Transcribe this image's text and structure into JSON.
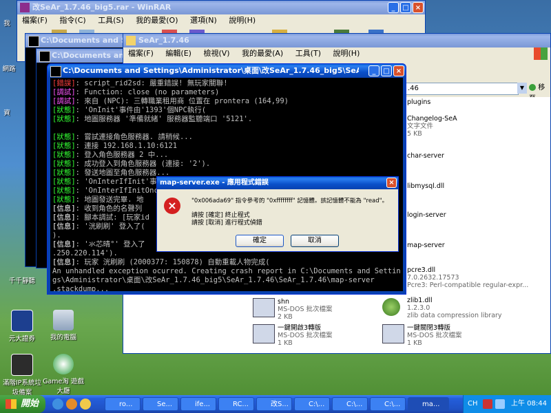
{
  "desktop": {
    "icons": [
      {
        "label": "我",
        "x": 0
      },
      {
        "label": "網路",
        "x": 0
      },
      {
        "label": "資",
        "x": 0
      },
      {
        "label": "千千靜聽"
      },
      {
        "label": "元大證券"
      },
      {
        "label": "我的電腦"
      },
      {
        "label": "滿階IP系統垃圾備案"
      },
      {
        "label": "Game淘 遊戲大廳"
      }
    ]
  },
  "winrar": {
    "title": "改SeAr_1.7.46_big5.rar - WinRAR",
    "menu": [
      "檔案(F)",
      "指令(C)",
      "工具(S)",
      "我的最愛(O)",
      "選項(N)",
      "說明(H)"
    ]
  },
  "cmd_back1": {
    "title": "C:\\Documents and Settings\\"
  },
  "cmd_back2": {
    "title": "C:\\Documents and Settings\\"
  },
  "explorer": {
    "title": "SeAr_1.7.46",
    "menu": [
      "檔案(F)",
      "編輯(E)",
      "檢視(V)",
      "我的最愛(A)",
      "工具(T)",
      "說明(H)"
    ],
    "address_value": ".46",
    "go_label": "移至",
    "files": [
      {
        "name": "plugins",
        "type": "",
        "size": ""
      },
      {
        "name": "Changelog-SeA",
        "type": "文字文件",
        "size": "5 KB"
      },
      {
        "name": "char-server",
        "type": "",
        "size": ""
      },
      {
        "name": "libmysql.dll",
        "type": "",
        "size": ""
      },
      {
        "name": "login-server",
        "type": "",
        "size": ""
      },
      {
        "name": "map-server",
        "type": "",
        "size": ""
      },
      {
        "name": "pcre3.dll",
        "type": "7.0.2632.17573",
        "size": "Pcre3: Perl-compatible regular-expr..."
      },
      {
        "name": "zlib1.dll",
        "type": "1.2.3.0",
        "size": "zlib data compression library"
      },
      {
        "name": "shn",
        "type": "MS-DOS 批次檔案",
        "size": "2 KB"
      },
      {
        "name": "一鍵開啟3轉版",
        "type": "MS-DOS 批次檔案",
        "size": "1 KB"
      },
      {
        "name": "一鍵關閉3轉版",
        "type": "MS-DOS 批次檔案",
        "size": "1 KB"
      },
      {
        "name": "",
        "type": "MS-DOS 批次檔案",
        "size": "1 KB"
      }
    ]
  },
  "console": {
    "title": "C:\\Documents and Settings\\Administrator\\桌面\\改SeAr_1.7.46_big5\\SeAr_1.7.46\\",
    "lines": [
      {
        "tag": "[錯誤]",
        "tag_color": "c-red",
        "text": ": script_rid2sd: 嚴重錯誤! 無玩家關聯!"
      },
      {
        "tag": "[調試]",
        "tag_color": "c-mag",
        "text": ": Function: close (no parameters)"
      },
      {
        "tag": "[調試]",
        "tag_color": "c-mag",
        "text": ": 來自 (NPC): 三轉職業租用商 位置在 prontera (164,99)"
      },
      {
        "tag": "[狀態]",
        "tag_color": "c-grn",
        "text": ": 'OnInit'事件由'1393'個NPC執行("
      },
      {
        "tag": "[狀態]",
        "tag_color": "c-grn",
        "text": ": 地圖服務器 '準備就緒' 服務器監聽端口 '5121'."
      },
      {
        "tag": "",
        "tag_color": "",
        "text": ""
      },
      {
        "tag": "[狀態]",
        "tag_color": "c-grn",
        "text": ": 嘗試連接角色服務器. 請稍候..."
      },
      {
        "tag": "[狀態]",
        "tag_color": "c-grn",
        "text": ": 連接 192.168.1.10:6121"
      },
      {
        "tag": "[狀態]",
        "tag_color": "c-grn",
        "text": ": 登入角色服務器 2 中..."
      },
      {
        "tag": "[狀態]",
        "tag_color": "c-grn",
        "text": ": 成功登入到角色服務器 (連接: '2')."
      },
      {
        "tag": "[狀態]",
        "tag_color": "c-grn",
        "text": ": 發送地圖至角色服務器..."
      },
      {
        "tag": "[狀態]",
        "tag_color": "c-grn",
        "text": ": 'OnInterIfInit'事"
      },
      {
        "tag": "[狀態]",
        "tag_color": "c-grn",
        "text": ": 'OnInterIfInitOnc"
      },
      {
        "tag": "[狀態]",
        "tag_color": "c-grn",
        "text": ": 地圖發送完畢. 地"
      },
      {
        "tag": "[信息]",
        "tag_color": "c-wht",
        "text": ": 收到角色的名聲列"
      },
      {
        "tag": "[信息]",
        "tag_color": "c-wht",
        "text": ": 腳本調試: [玩家id"
      },
      {
        "tag": "[信息]",
        "tag_color": "c-wht",
        "text": ": '洸刷刷' 登入了("
      },
      {
        "tag": "",
        "tag_color": "",
        "text": ")."
      },
      {
        "tag": "[信息]",
        "tag_color": "c-wht",
        "text": ": '氺芯晴°' 登入了"
      },
      {
        "tag": "",
        "tag_color": "",
        "text": ".250.220.114')."
      },
      {
        "tag": "[信息]",
        "tag_color": "c-wht",
        "text": ": 玩家 洸刷刷 (2000377: 150878) 自動重載人物完成("
      },
      {
        "tag": "",
        "tag_color": "",
        "text": "An unhandled exception ocurred. Creating crash report in C:\\Documents and Settin"
      },
      {
        "tag": "",
        "tag_color": "",
        "text": "gs\\Administrator\\桌面\\改SeAr_1.7.46_big5\\SeAr_1.7.46\\SeAr_1.7.46\\map-server"
      },
      {
        "tag": "",
        "tag_color": "",
        "text": ".stackdump..."
      }
    ]
  },
  "dialog": {
    "title": "map-server.exe - 應用程式錯誤",
    "message": "\"0x006ada69\" 指令參考的 \"0xffffffff\" 記憶體。該記憶體不能為 \"read\"。",
    "hint1": "請按 [確定] 終止程式",
    "hint2": "請按 [取消] 進行程式偵錯",
    "ok_label": "確定",
    "cancel_label": "取消"
  },
  "taskbar": {
    "start_label": "開始",
    "buttons": [
      "ro...",
      "Se...",
      "ife...",
      "RC...",
      "改S...",
      "C:\\...",
      "C:\\...",
      "C:\\...",
      "ma..."
    ],
    "lang": "CH",
    "clock": "上午 08:44"
  },
  "colors": {
    "xp_blue": "#0a4fc9",
    "console_bg": "#000000",
    "dialog_bg": "#ece9d8"
  }
}
